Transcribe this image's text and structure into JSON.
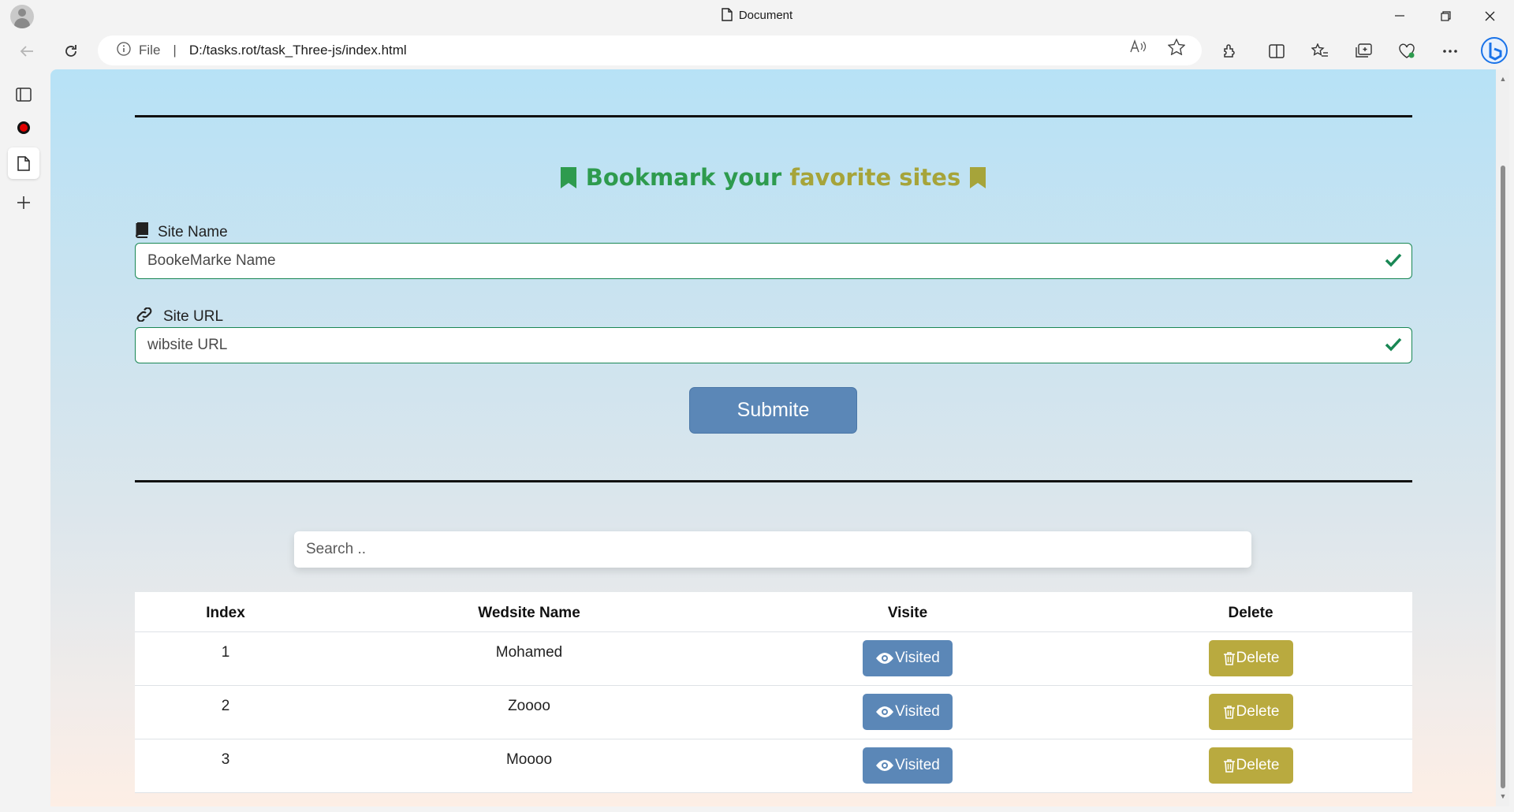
{
  "browser": {
    "tab_title": "Document",
    "address": {
      "scheme_label": "File",
      "url": "D:/tasks.rot/task_Three-js/index.html"
    }
  },
  "page": {
    "heading": {
      "word_green": "Bookmark your",
      "word_olive": "favorite sites"
    },
    "site_name": {
      "label": "Site Name",
      "placeholder": "BookeMarke Name"
    },
    "site_url": {
      "label": "Site URL",
      "placeholder": "wibsite URL"
    },
    "submit_label": "Submite",
    "search_placeholder": "Search ..",
    "table": {
      "headers": [
        "Index",
        "Wedsite Name",
        "Visite",
        "Delete"
      ],
      "rows": [
        {
          "index": "1",
          "name": "Mohamed",
          "visit": "Visited",
          "delete": "Delete"
        },
        {
          "index": "2",
          "name": "Zoooo",
          "visit": "Visited",
          "delete": "Delete"
        },
        {
          "index": "3",
          "name": "Moooo",
          "visit": "Visited",
          "delete": "Delete"
        }
      ]
    }
  },
  "colors": {
    "green": "#2e9b4e",
    "olive": "#a6a43a",
    "primary_button": "#5b87b7",
    "delete_button": "#b9aa3f",
    "valid_border": "#198754"
  }
}
